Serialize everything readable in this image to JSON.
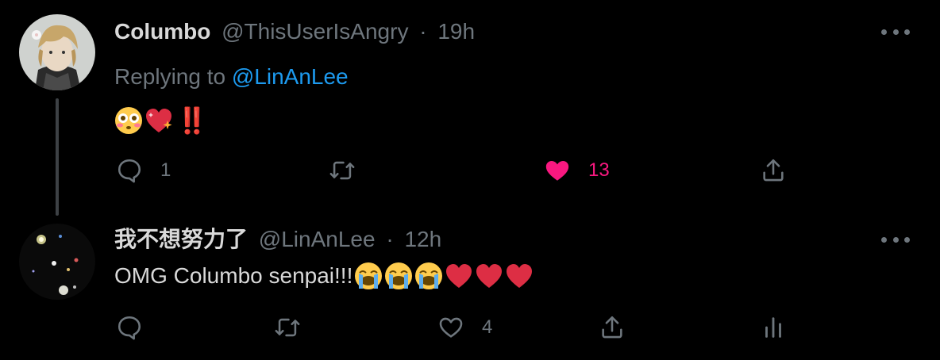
{
  "tweet1": {
    "name": "Columbo",
    "handle": "@ThisUserIsAngry",
    "separator": "·",
    "time": "19h",
    "replying_prefix": "Replying to ",
    "replying_handle": "@LinAnLee",
    "content": {
      "emojis": [
        "flushed-face",
        "sparkling-heart"
      ],
      "text": "‼️"
    },
    "actions": {
      "reply_count": "1",
      "retweet_count": "",
      "like_count": "13",
      "liked": true
    }
  },
  "tweet2": {
    "name": "我不想努力了",
    "handle": "@LinAnLee",
    "separator": "·",
    "time": "12h",
    "content": {
      "text": "OMG Columbo senpai!!!",
      "emojis": [
        "loudly-crying-face",
        "loudly-crying-face",
        "loudly-crying-face",
        "red-heart",
        "red-heart",
        "red-heart"
      ]
    },
    "actions": {
      "reply_count": "",
      "retweet_count": "",
      "like_count": "4",
      "liked": false
    }
  },
  "colors": {
    "background": "#000000",
    "text": "#d9d9d9",
    "muted": "#6e767d",
    "link": "#1d9bf0",
    "like": "#f91880",
    "thread_line": "#3d4145"
  }
}
